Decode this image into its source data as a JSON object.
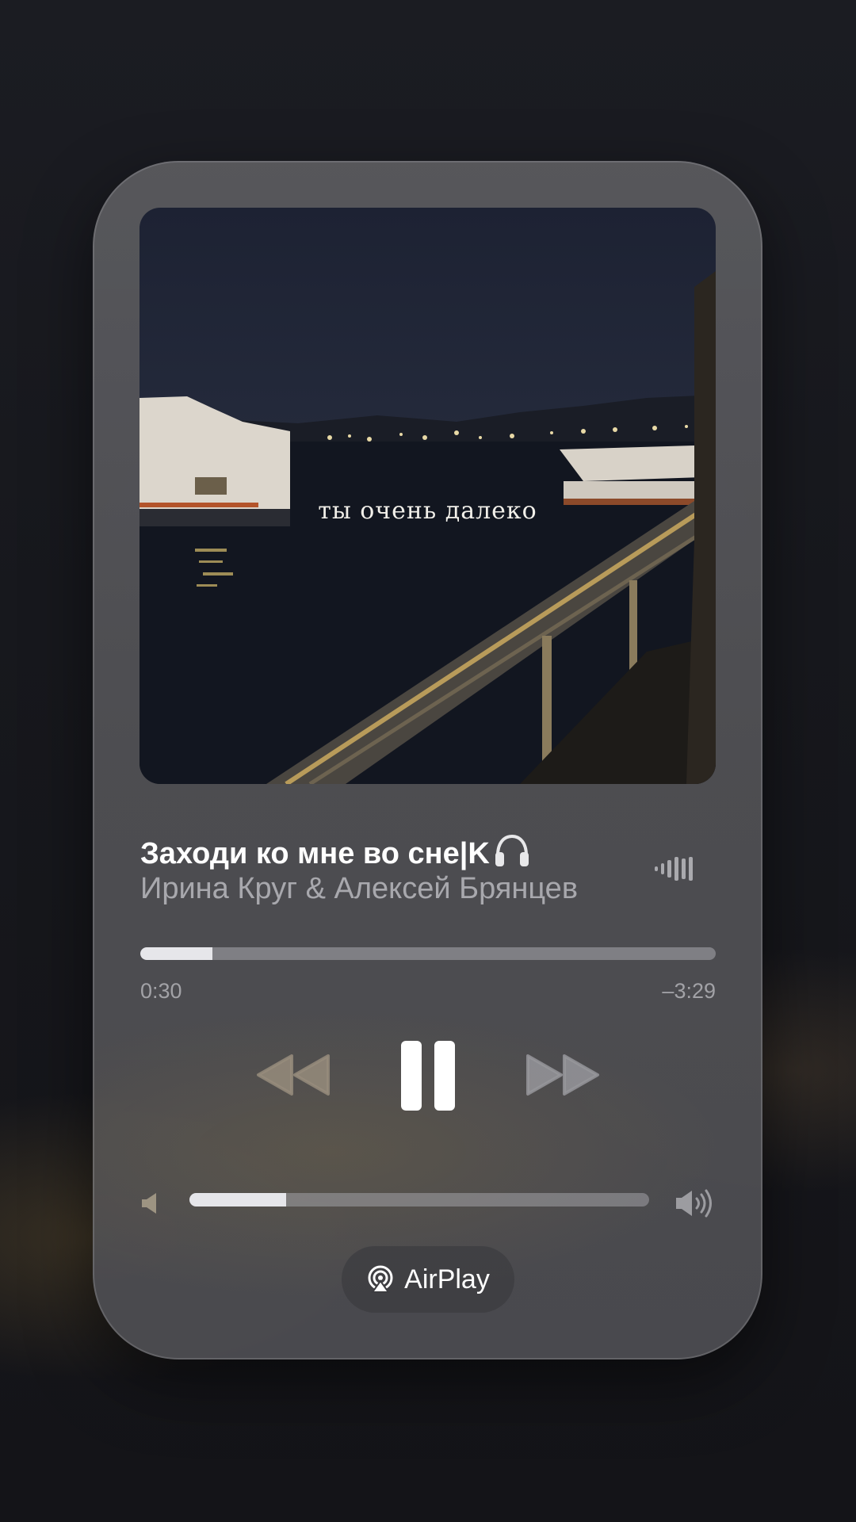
{
  "artwork": {
    "caption": "ты очень далеко"
  },
  "track": {
    "title": "Заходи ко мне во сне|K",
    "title_icon": "headphones-icon",
    "artist": "Ирина Круг & Алексей Брянцев",
    "status_icon": "equalizer-icon"
  },
  "playback": {
    "elapsed": "0:30",
    "remaining": "–3:29",
    "progress_fraction": 0.125,
    "state": "playing"
  },
  "controls": {
    "rewind_icon": "rewind-icon",
    "pause_icon": "pause-icon",
    "forward_icon": "fast-forward-icon"
  },
  "volume": {
    "level_fraction": 0.21,
    "low_icon": "speaker-low-icon",
    "high_icon": "speaker-high-icon"
  },
  "airplay": {
    "label": "AirPlay",
    "icon": "airplay-icon"
  },
  "colors": {
    "card": "#58585c",
    "progress_fill": "#e6e6ea",
    "text_primary": "#ffffff",
    "text_secondary": "#a6a6ab"
  }
}
